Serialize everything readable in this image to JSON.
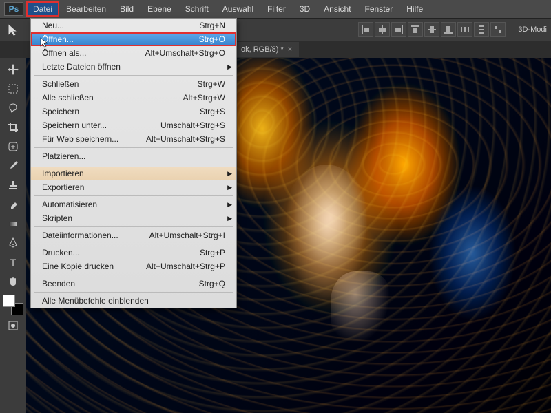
{
  "app": {
    "logo": "Ps"
  },
  "menubar": [
    "Datei",
    "Bearbeiten",
    "Bild",
    "Ebene",
    "Schrift",
    "Auswahl",
    "Filter",
    "3D",
    "Ansicht",
    "Fenster",
    "Hilfe"
  ],
  "active_menu_index": 0,
  "dropdown": {
    "groups": [
      [
        {
          "label": "Neu...",
          "shortcut": "Strg+N",
          "sub": false
        },
        {
          "label": "Öffnen...",
          "shortcut": "Strg+O",
          "sub": false,
          "highlight": true
        },
        {
          "label": "Öffnen als...",
          "shortcut": "Alt+Umschalt+Strg+O",
          "sub": false
        },
        {
          "label": "Letzte Dateien öffnen",
          "shortcut": "",
          "sub": true
        }
      ],
      [
        {
          "label": "Schließen",
          "shortcut": "Strg+W",
          "sub": false
        },
        {
          "label": "Alle schließen",
          "shortcut": "Alt+Strg+W",
          "sub": false
        },
        {
          "label": "Speichern",
          "shortcut": "Strg+S",
          "sub": false
        },
        {
          "label": "Speichern unter...",
          "shortcut": "Umschalt+Strg+S",
          "sub": false
        },
        {
          "label": "Für Web speichern...",
          "shortcut": "Alt+Umschalt+Strg+S",
          "sub": false
        }
      ],
      [
        {
          "label": "Platzieren...",
          "shortcut": "",
          "sub": false
        }
      ],
      [
        {
          "label": "Importieren",
          "shortcut": "",
          "sub": true,
          "warm": true
        },
        {
          "label": "Exportieren",
          "shortcut": "",
          "sub": true
        }
      ],
      [
        {
          "label": "Automatisieren",
          "shortcut": "",
          "sub": true
        },
        {
          "label": "Skripten",
          "shortcut": "",
          "sub": true
        }
      ],
      [
        {
          "label": "Dateiinformationen...",
          "shortcut": "Alt+Umschalt+Strg+I",
          "sub": false
        }
      ],
      [
        {
          "label": "Drucken...",
          "shortcut": "Strg+P",
          "sub": false
        },
        {
          "label": "Eine Kopie drucken",
          "shortcut": "Alt+Umschalt+Strg+P",
          "sub": false
        }
      ],
      [
        {
          "label": "Beenden",
          "shortcut": "Strg+Q",
          "sub": false
        }
      ],
      [
        {
          "label": "Alle Menübefehle einblenden",
          "shortcut": "",
          "sub": false
        }
      ]
    ]
  },
  "document_tab": {
    "title": "ok, RGB/8) *"
  },
  "option_bar": {
    "mode_label": "3D-Modi"
  },
  "tools": [
    "move",
    "marquee",
    "lasso",
    "crop",
    "healing",
    "brush",
    "stamp",
    "eraser",
    "gradient",
    "pen",
    "text",
    "hand"
  ],
  "swatches": {
    "fg": "#ffffff",
    "bg": "#000000"
  }
}
